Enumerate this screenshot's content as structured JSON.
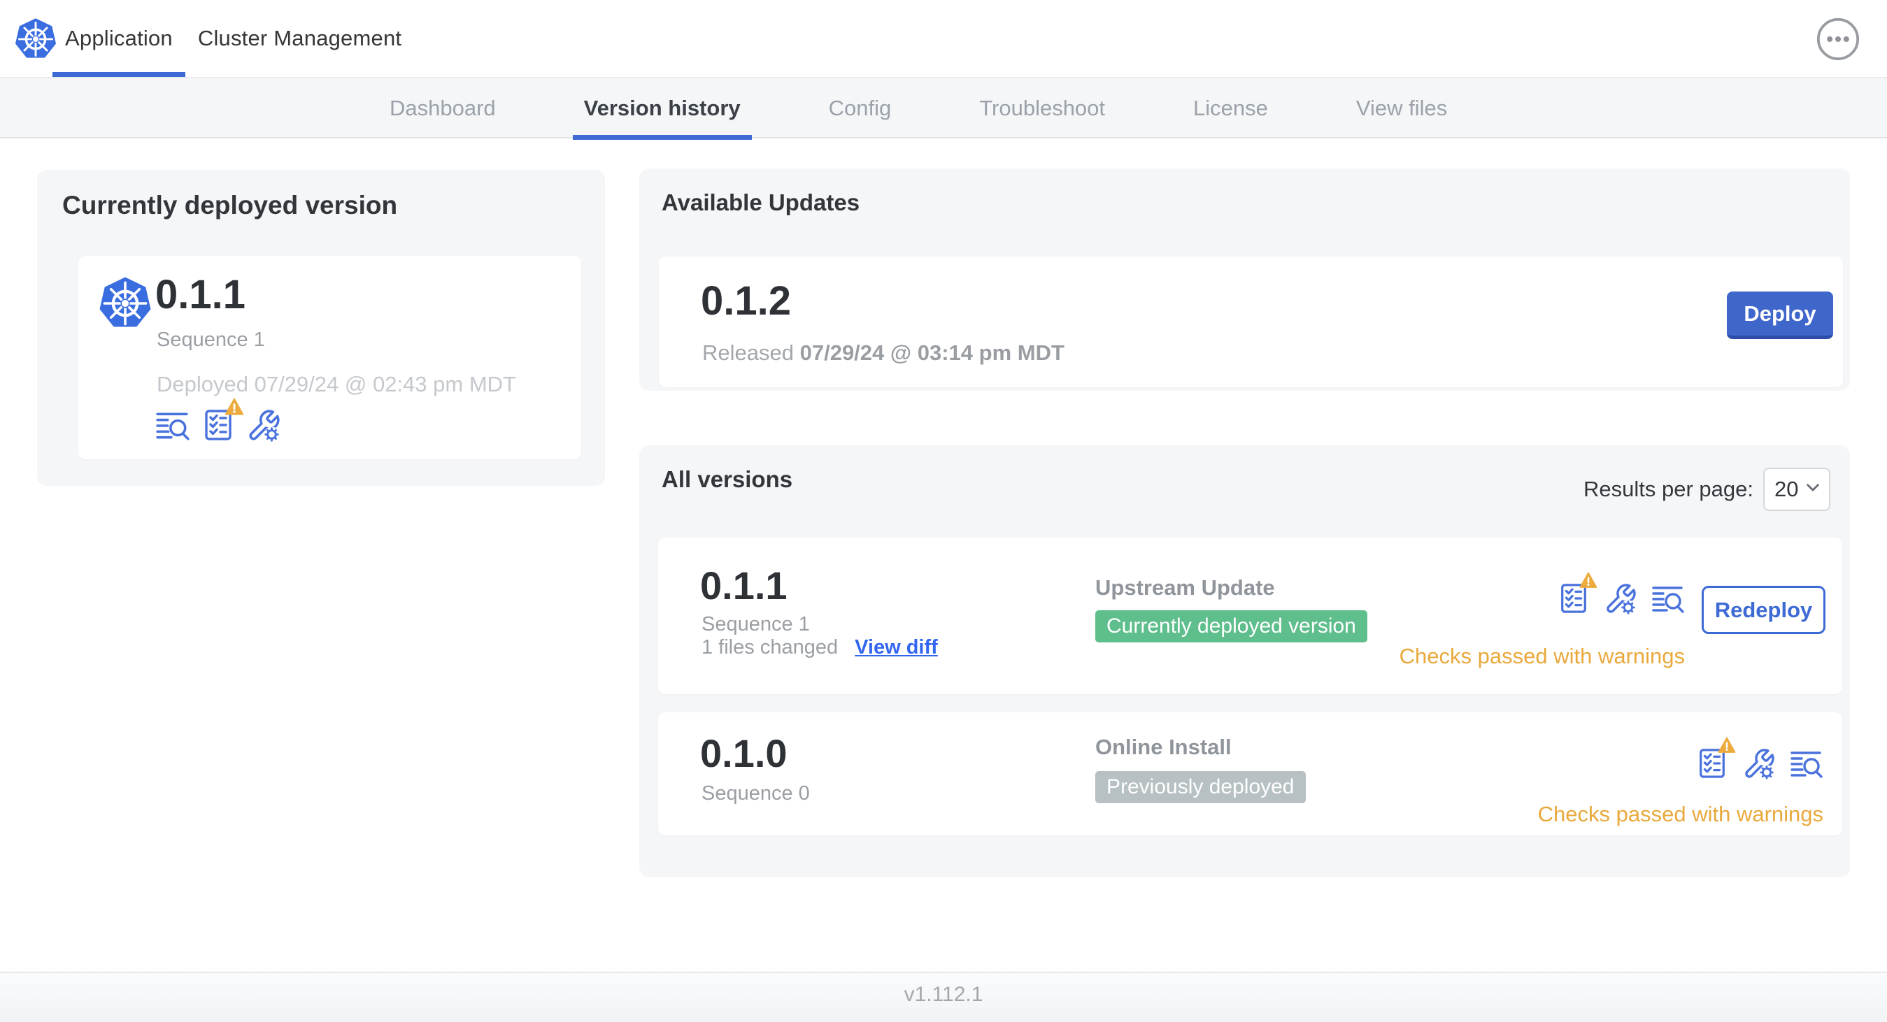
{
  "header": {
    "tabs": [
      {
        "label": "Application"
      },
      {
        "label": "Cluster Management"
      }
    ],
    "active_tab": "Application"
  },
  "subnav": {
    "tabs": [
      {
        "label": "Dashboard"
      },
      {
        "label": "Version history"
      },
      {
        "label": "Config"
      },
      {
        "label": "Troubleshoot"
      },
      {
        "label": "License"
      },
      {
        "label": "View files"
      }
    ],
    "active_tab": "Version history"
  },
  "deployed_card": {
    "title": "Currently deployed version",
    "version": "0.1.1",
    "sequence": "Sequence 1",
    "deployed_at": "Deployed 07/29/24 @ 02:43 pm MDT"
  },
  "available_updates": {
    "title": "Available Updates",
    "version": "0.1.2",
    "released_prefix": "Released",
    "released_date": "07/29/24 @ 03:14 pm MDT",
    "deploy_label": "Deploy"
  },
  "all_versions": {
    "title": "All versions",
    "results_per_page_label": "Results per page:",
    "results_per_page_value": "20",
    "rows": [
      {
        "version": "0.1.1",
        "sequence": "Sequence 1",
        "files_changed": "1 files changed",
        "view_diff_label": "View diff",
        "source": "Upstream Update",
        "badge": "Currently deployed version",
        "badge_color": "#5ebe8c",
        "status": "Checks passed with warnings",
        "action_label": "Redeploy"
      },
      {
        "version": "0.1.0",
        "sequence": "Sequence 0",
        "source": "Online Install",
        "badge": "Previously deployed",
        "badge_color": "#b7c0c3",
        "status": "Checks passed with warnings"
      }
    ]
  },
  "footer": {
    "version": "v1.112.1"
  },
  "icons": {
    "logo": "kubernetes-logo",
    "row_icons": [
      "preflight-checks-icon",
      "config-icon",
      "diff-icon"
    ],
    "deployed_icons": [
      "diff-icon",
      "preflight-checks-icon",
      "config-icon"
    ]
  },
  "colors": {
    "accent_blue": "#3d6ad4",
    "deploy_button": "#3f67cb",
    "link_blue": "#3366f0",
    "badge_green": "#5ebe8c",
    "badge_gray": "#b7c0c3",
    "warning_amber": "#e9a93d",
    "card_gray": "#f5f6f8"
  }
}
